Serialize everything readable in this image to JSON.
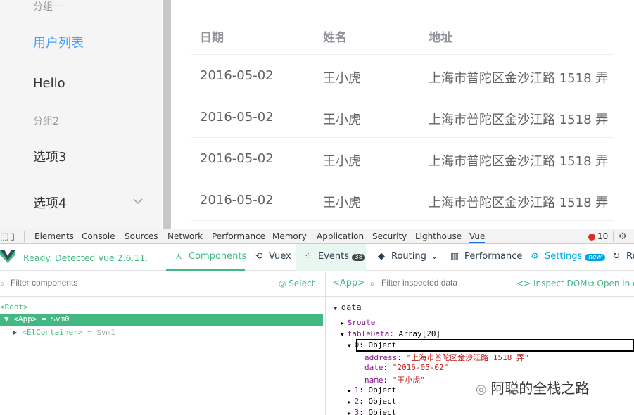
{
  "menu": {
    "group1": "分组一",
    "item_users": "用户列表",
    "item_hello": "Hello",
    "group2": "分组2",
    "item_option3": "选项3",
    "item_option4": "选项4"
  },
  "table": {
    "headers": [
      "日期",
      "姓名",
      "地址"
    ],
    "rows": [
      {
        "date": "2016-05-02",
        "name": "王小虎",
        "address": "上海市普陀区金沙江路 1518 弄"
      },
      {
        "date": "2016-05-02",
        "name": "王小虎",
        "address": "上海市普陀区金沙江路 1518 弄"
      },
      {
        "date": "2016-05-02",
        "name": "王小虎",
        "address": "上海市普陀区金沙江路 1518 弄"
      },
      {
        "date": "2016-05-02",
        "name": "王小虎",
        "address": "上海市普陀区金沙江路 1518 弄"
      }
    ]
  },
  "devtools": {
    "tabs": [
      "Elements",
      "Console",
      "Sources",
      "Network",
      "Performance",
      "Memory",
      "Application",
      "Security",
      "Lighthouse",
      "Vue"
    ],
    "error_count": "10"
  },
  "vue": {
    "ready": "Ready. Detected Vue 2.6.11.",
    "components": "Components",
    "vuex": "Vuex",
    "events": "Events",
    "events_badge": "38",
    "routing": "Routing",
    "performance": "Performance",
    "settings": "Settings",
    "settings_badge": "new",
    "refresh": "Re"
  },
  "left": {
    "filter_placeholder": "Filter components",
    "select": "Select",
    "root": "<Root>",
    "app_tag": "<App>",
    "app_vm": " = $vm0",
    "container_tag": "<ElContainer>",
    "container_vm": " = $vm1"
  },
  "right": {
    "app_label": "<App>",
    "filter_placeholder": "Filter inspected data",
    "inspect_dom": "Inspect DOM",
    "open_in": "Open in e",
    "data_label": "data",
    "route_key": "$route",
    "table_key": "tableData",
    "table_val": "Array[20]",
    "obj0_key": "0",
    "obj_val": "Object",
    "address_key": "address",
    "address_val": "\"上海市普陀区金沙江路 1518 弄\"",
    "date_key": "date",
    "date_val": "\"2016-05-02\"",
    "name_key": "name",
    "name_val": "\"王小虎\"",
    "obj1_key": "1",
    "obj2_key": "2",
    "obj3_key": "3"
  },
  "watermark": "阿聪的全栈之路",
  "colors": {
    "accent_blue": "#409eff",
    "vue_green": "#42b883",
    "settings_blue": "#00a6e0"
  }
}
